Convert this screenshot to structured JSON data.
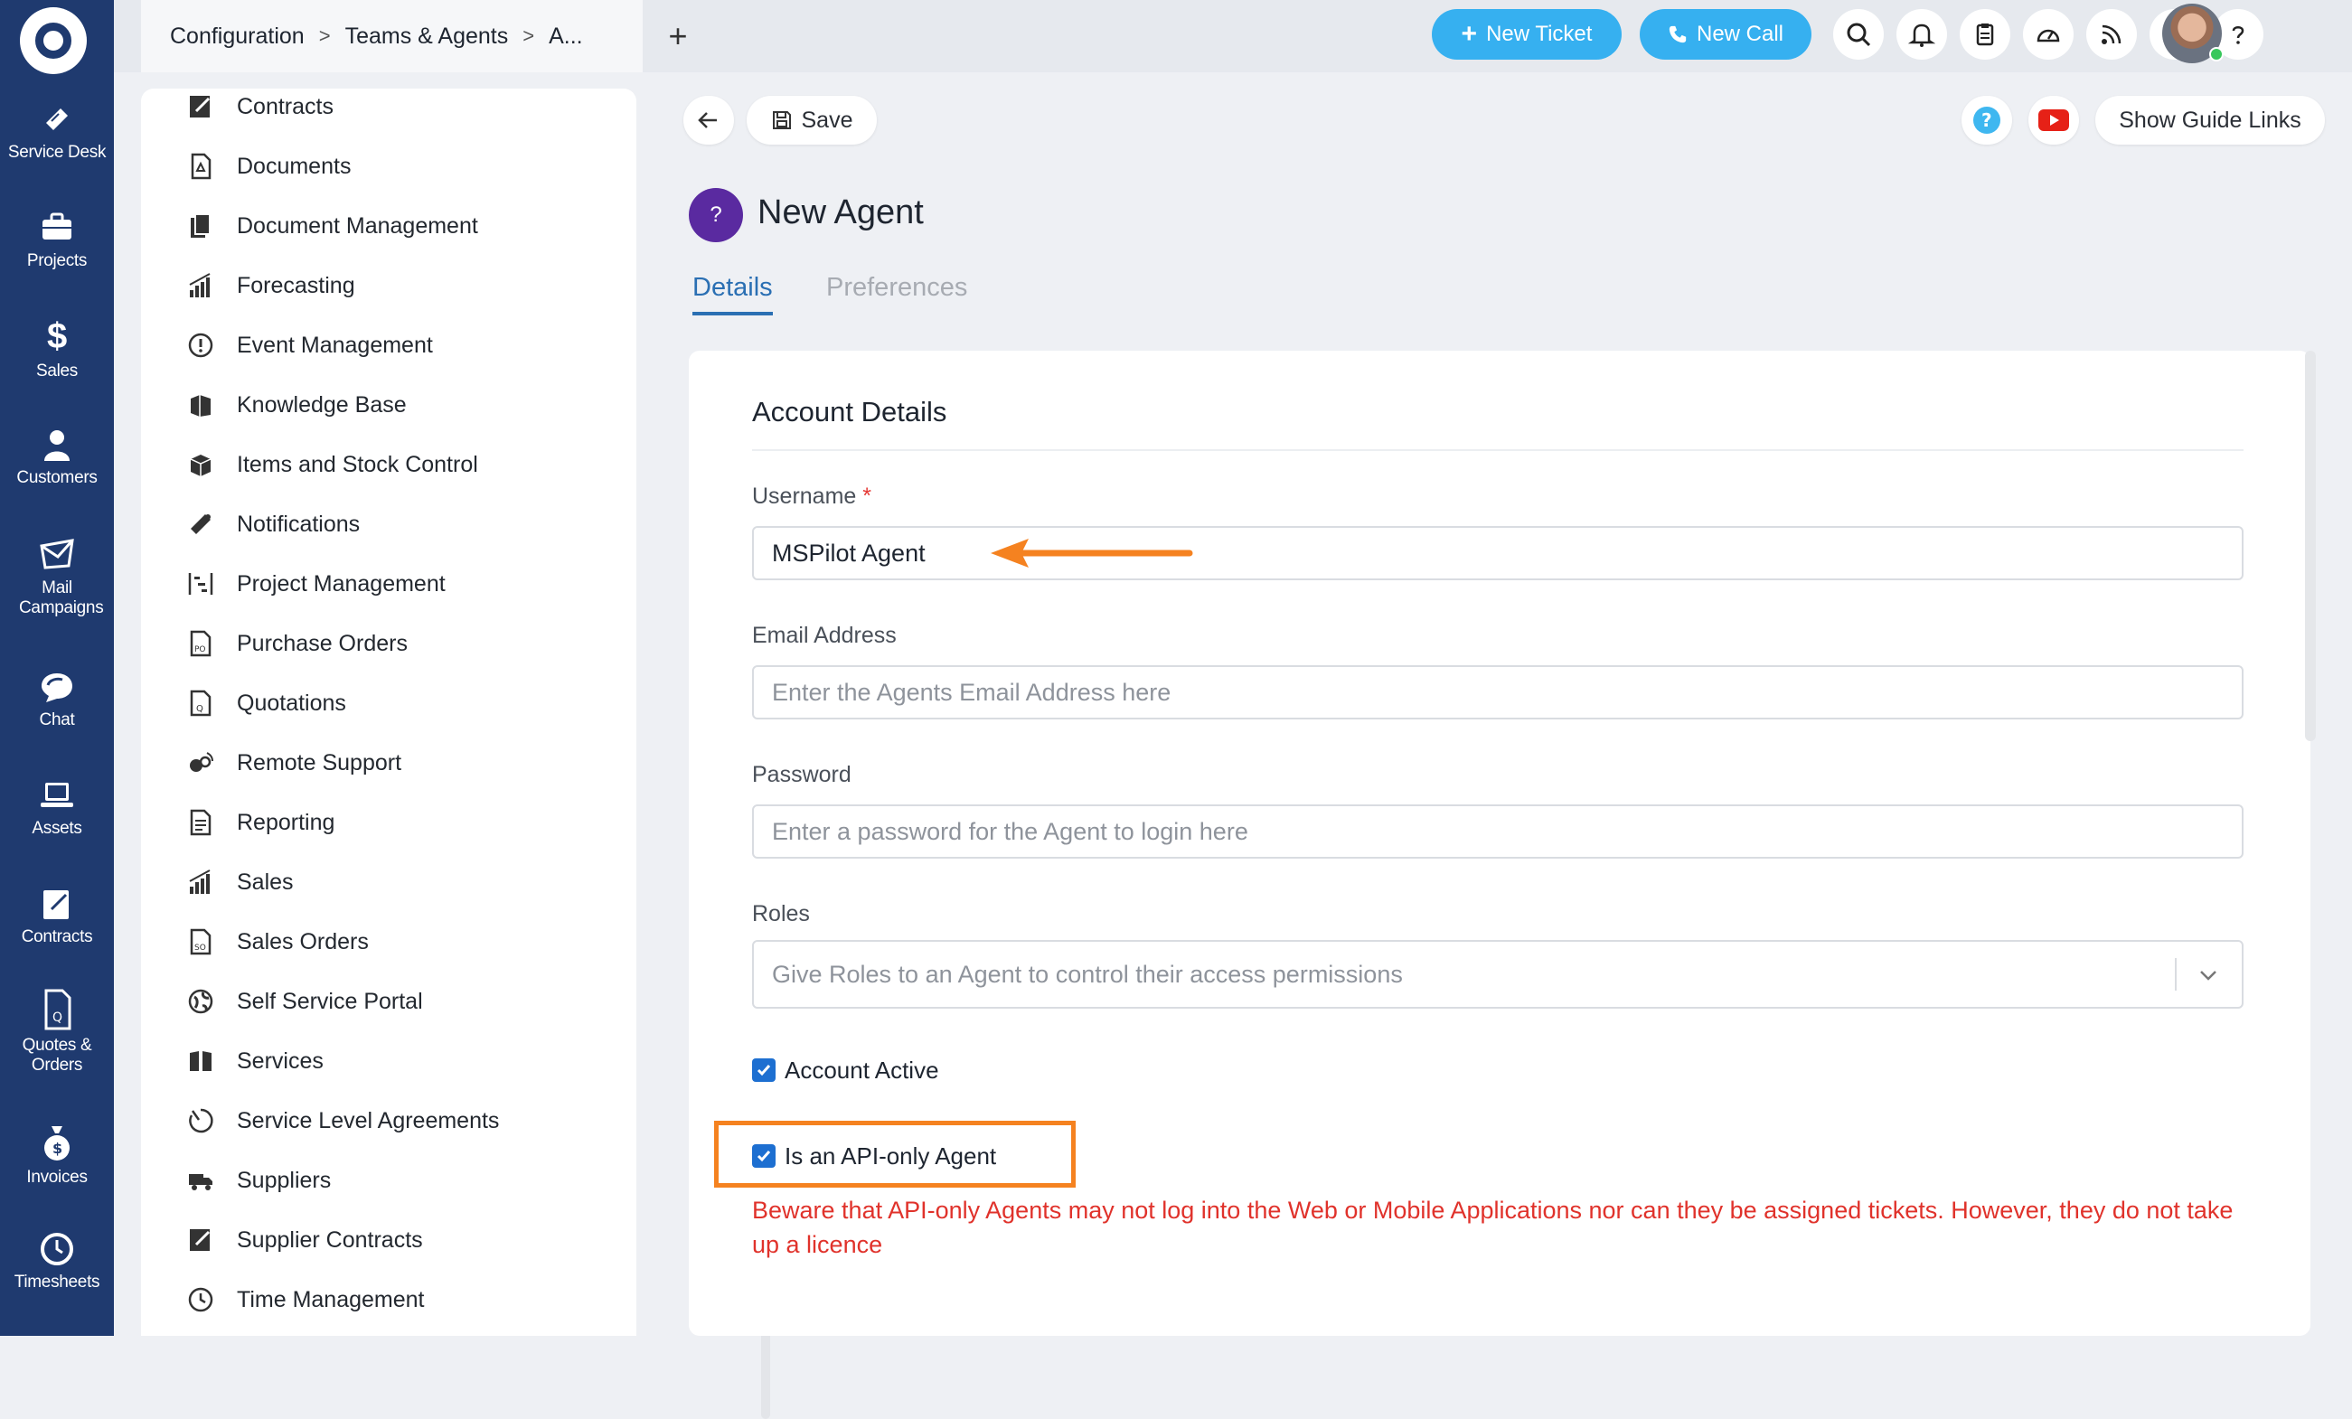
{
  "rail": {
    "items": [
      {
        "label": "Service Desk",
        "icon": "ticket-icon"
      },
      {
        "label": "Projects",
        "icon": "briefcase-icon"
      },
      {
        "label": "Sales",
        "icon": "dollar-icon"
      },
      {
        "label": "Customers",
        "icon": "person-icon"
      },
      {
        "label": "Mail Campaigns",
        "icon": "envelope-icon"
      },
      {
        "label": "Chat",
        "icon": "chat-icon"
      },
      {
        "label": "Assets",
        "icon": "laptop-icon"
      },
      {
        "label": "Contracts",
        "icon": "contract-icon"
      },
      {
        "label": "Quotes & Orders",
        "icon": "quote-icon"
      },
      {
        "label": "Invoices",
        "icon": "money-bag-icon"
      },
      {
        "label": "Timesheets",
        "icon": "clock-icon"
      }
    ]
  },
  "breadcrumb": {
    "items": [
      "Configuration",
      "Teams & Agents",
      "A..."
    ],
    "separator": ">"
  },
  "topbar": {
    "new_ticket": "New Ticket",
    "new_call": "New Call",
    "icons": [
      "search-icon",
      "bell-icon",
      "clipboard-icon",
      "dashboard-icon",
      "rss-icon",
      "clock-icon",
      "help-icon"
    ]
  },
  "config_menu": {
    "items": [
      "Contracts",
      "Documents",
      "Document Management",
      "Forecasting",
      "Event Management",
      "Knowledge Base",
      "Items and Stock Control",
      "Notifications",
      "Project Management",
      "Purchase Orders",
      "Quotations",
      "Remote Support",
      "Reporting",
      "Sales",
      "Sales Orders",
      "Self Service Portal",
      "Services",
      "Service Level Agreements",
      "Suppliers",
      "Supplier Contracts",
      "Time Management"
    ]
  },
  "toolbar": {
    "save": "Save",
    "guide": "Show Guide Links"
  },
  "page": {
    "icon_text": "?",
    "title": "New Agent"
  },
  "tabs": {
    "details": "Details",
    "preferences": "Preferences"
  },
  "form": {
    "section_title": "Account Details",
    "username": {
      "label": "Username",
      "required": "*",
      "value": "MSPilot Agent"
    },
    "email": {
      "label": "Email Address",
      "placeholder": "Enter the Agents Email Address here"
    },
    "password": {
      "label": "Password",
      "placeholder": "Enter a password for the Agent to login here"
    },
    "roles": {
      "label": "Roles",
      "placeholder": "Give Roles to an Agent to control their access permissions"
    },
    "account_active": {
      "label": "Account Active",
      "checked": true
    },
    "api_only": {
      "label": "Is an API-only Agent",
      "checked": true
    },
    "warning": "Beware that API-only Agents may not log into the Web or Mobile Applications nor can they be assigned tickets. However, they do not take up a licence"
  },
  "colors": {
    "rail": "#1f3a6f",
    "accent": "#36b0f0",
    "link": "#2a6fb3",
    "annotation": "#f58220",
    "warning": "#e0322b"
  }
}
